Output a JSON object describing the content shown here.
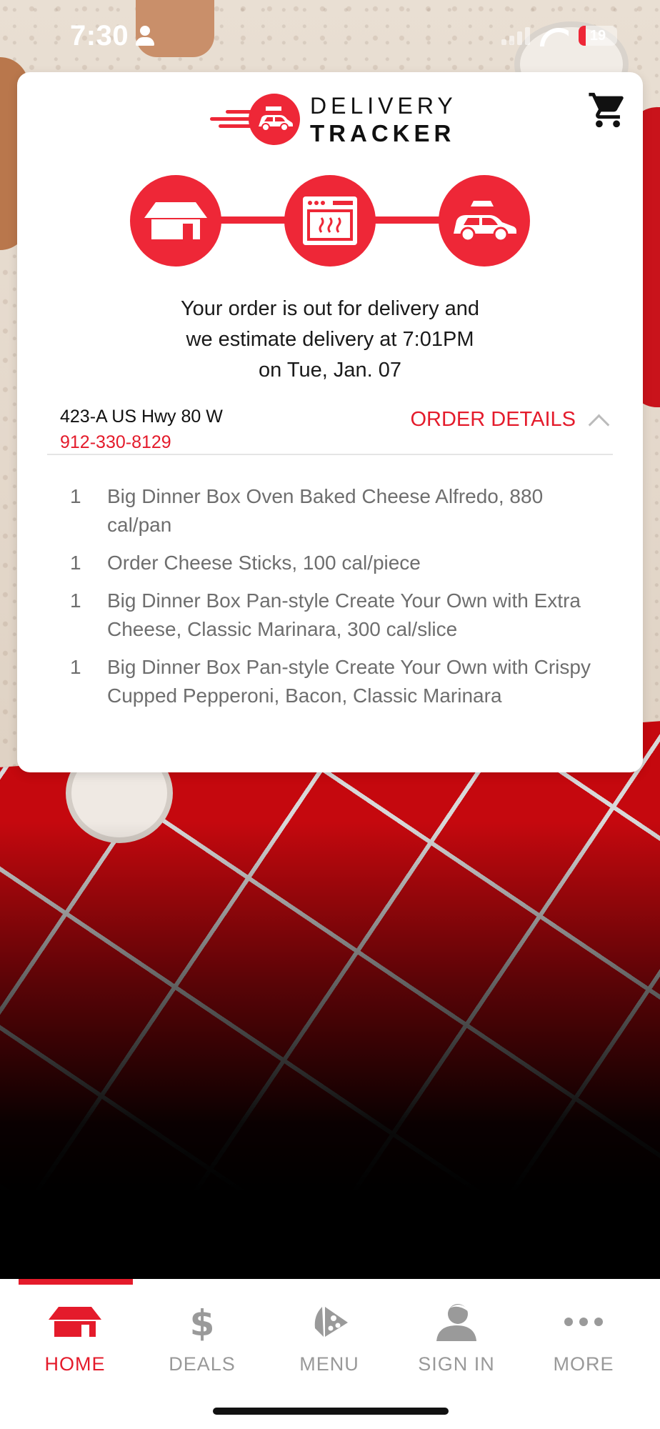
{
  "status_bar": {
    "time": "7:30",
    "battery": "19"
  },
  "brand": {
    "line1": "DELIVERY",
    "line2": "TRACKER"
  },
  "tracker": {
    "stages": [
      "store-icon",
      "oven-icon",
      "delivery-car-icon"
    ],
    "status_lines": [
      "Your order is out for delivery and",
      "we estimate delivery at 7:01PM",
      "on Tue, Jan. 07"
    ]
  },
  "store": {
    "address": "423-A US Hwy 80 W",
    "phone": "912-330-8129"
  },
  "order_details": {
    "toggle_label": "ORDER DETAILS",
    "items": [
      {
        "qty": "1",
        "name": "Big Dinner Box Oven Baked Cheese Alfredo, 880 cal/pan"
      },
      {
        "qty": "1",
        "name": "Order Cheese Sticks, 100 cal/piece"
      },
      {
        "qty": "1",
        "name": "Big Dinner Box Pan-style Create Your Own with Extra Cheese, Classic Marinara, 300 cal/slice"
      },
      {
        "qty": "1",
        "name": "Big Dinner Box Pan-style Create Your Own with Crispy Cupped Pepperoni, Bacon, Classic Marinara"
      }
    ]
  },
  "nav": {
    "items": [
      {
        "label": "HOME",
        "icon": "hut-icon",
        "active": true
      },
      {
        "label": "DEALS",
        "icon": "dollar-icon",
        "active": false
      },
      {
        "label": "MENU",
        "icon": "pizza-slice-icon",
        "active": false
      },
      {
        "label": "SIGN IN",
        "icon": "user-icon",
        "active": false
      },
      {
        "label": "MORE",
        "icon": "more-dots-icon",
        "active": false
      }
    ]
  },
  "colors": {
    "accent": "#e41b2b",
    "text": "#1a1a1a",
    "muted": "#6e6e6e"
  }
}
